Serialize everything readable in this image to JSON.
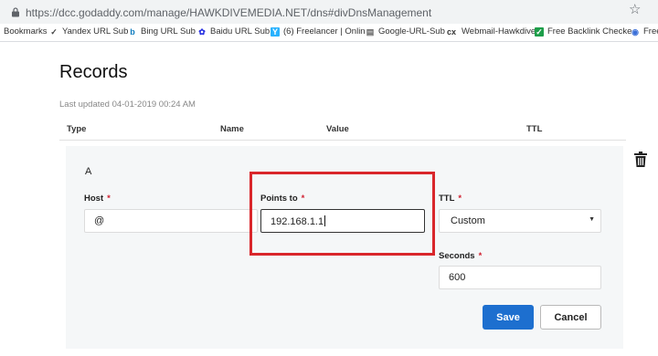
{
  "browser": {
    "url": "https://dcc.godaddy.com/manage/HAWKDIVEMEDIA.NET/dns#divDnsManagement"
  },
  "bookmarks": [
    {
      "label": "Bookmarks",
      "icon": "none"
    },
    {
      "label": "Yandex URL Sub",
      "icon": "yandex-icon"
    },
    {
      "label": "Bing URL Sub",
      "icon": "bing-icon"
    },
    {
      "label": "Baidu URL Sub",
      "icon": "baidu-icon"
    },
    {
      "label": "(6) Freelancer | Onlin",
      "icon": "freelancer-icon"
    },
    {
      "label": "Google-URL-Sub",
      "icon": "page-icon"
    },
    {
      "label": "Webmail-Hawkdive",
      "icon": "webmail-icon"
    },
    {
      "label": "Free Backlink Checke",
      "icon": "checkbox-icon"
    },
    {
      "label": "Free",
      "icon": "globe-icon"
    }
  ],
  "page": {
    "title": "Records",
    "last_updated": "Last updated 04-01-2019 00:24 AM"
  },
  "table": {
    "headers": {
      "type": "Type",
      "name": "Name",
      "value": "Value",
      "ttl": "TTL"
    }
  },
  "record": {
    "type": "A",
    "host_label": "Host",
    "host_value": "@",
    "points_to_label": "Points to",
    "points_to_value": "192.168.1.1",
    "ttl_label": "TTL",
    "ttl_value": "Custom",
    "seconds_label": "Seconds",
    "seconds_value": "600",
    "required_mark": "*",
    "save_label": "Save",
    "cancel_label": "Cancel"
  },
  "colors": {
    "accent": "#1d6fcf",
    "highlight": "#d9262b",
    "required": "#d02030"
  }
}
